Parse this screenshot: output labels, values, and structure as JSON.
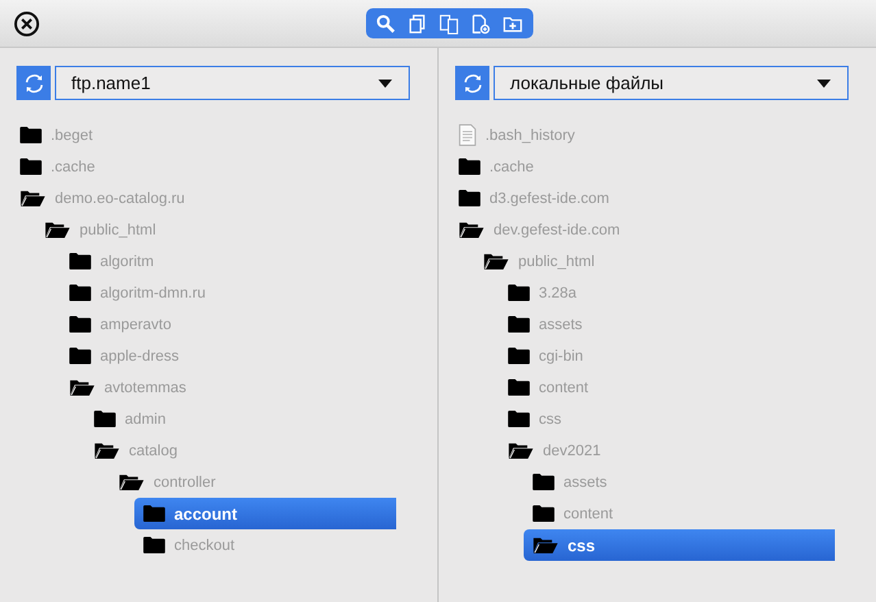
{
  "panes": [
    {
      "source": "ftp.name1",
      "tree": [
        {
          "name": ".beget",
          "kind": "folder",
          "expanded": false,
          "selected": false
        },
        {
          "name": ".cache",
          "kind": "folder",
          "expanded": false,
          "selected": false
        },
        {
          "name": "demo.eo-catalog.ru",
          "kind": "folder",
          "expanded": true,
          "selected": false,
          "children": [
            {
              "name": "public_html",
              "kind": "folder",
              "expanded": true,
              "selected": false,
              "children": [
                {
                  "name": "algoritm",
                  "kind": "folder",
                  "expanded": false,
                  "selected": false
                },
                {
                  "name": "algoritm-dmn.ru",
                  "kind": "folder",
                  "expanded": false,
                  "selected": false
                },
                {
                  "name": "amperavto",
                  "kind": "folder",
                  "expanded": false,
                  "selected": false
                },
                {
                  "name": "apple-dress",
                  "kind": "folder",
                  "expanded": false,
                  "selected": false
                },
                {
                  "name": "avtotemmas",
                  "kind": "folder",
                  "expanded": true,
                  "selected": false,
                  "children": [
                    {
                      "name": "admin",
                      "kind": "folder",
                      "expanded": false,
                      "selected": false
                    },
                    {
                      "name": "catalog",
                      "kind": "folder",
                      "expanded": true,
                      "selected": false,
                      "children": [
                        {
                          "name": "controller",
                          "kind": "folder",
                          "expanded": true,
                          "selected": false,
                          "children": [
                            {
                              "name": "account",
                              "kind": "folder",
                              "expanded": false,
                              "selected": true
                            },
                            {
                              "name": "checkout",
                              "kind": "folder",
                              "expanded": false,
                              "selected": false
                            }
                          ]
                        }
                      ]
                    }
                  ]
                }
              ]
            }
          ]
        }
      ]
    },
    {
      "source": "локальные файлы",
      "tree": [
        {
          "name": ".bash_history",
          "kind": "file",
          "selected": false
        },
        {
          "name": ".cache",
          "kind": "folder",
          "expanded": false,
          "selected": false
        },
        {
          "name": "d3.gefest-ide.com",
          "kind": "folder",
          "expanded": false,
          "selected": false
        },
        {
          "name": "dev.gefest-ide.com",
          "kind": "folder",
          "expanded": true,
          "selected": false,
          "children": [
            {
              "name": "public_html",
              "kind": "folder",
              "expanded": true,
              "selected": false,
              "children": [
                {
                  "name": "3.28a",
                  "kind": "folder",
                  "expanded": false,
                  "selected": false
                },
                {
                  "name": "assets",
                  "kind": "folder",
                  "expanded": false,
                  "selected": false
                },
                {
                  "name": "cgi-bin",
                  "kind": "folder",
                  "expanded": false,
                  "selected": false
                },
                {
                  "name": "content",
                  "kind": "folder",
                  "expanded": false,
                  "selected": false
                },
                {
                  "name": "css",
                  "kind": "folder",
                  "expanded": false,
                  "selected": false
                },
                {
                  "name": "dev2021",
                  "kind": "folder",
                  "expanded": true,
                  "selected": false,
                  "children": [
                    {
                      "name": "assets",
                      "kind": "folder",
                      "expanded": false,
                      "selected": false
                    },
                    {
                      "name": "content",
                      "kind": "folder",
                      "expanded": false,
                      "selected": false
                    },
                    {
                      "name": "css",
                      "kind": "folder",
                      "expanded": true,
                      "selected": true
                    }
                  ]
                }
              ]
            }
          ]
        }
      ]
    }
  ]
}
